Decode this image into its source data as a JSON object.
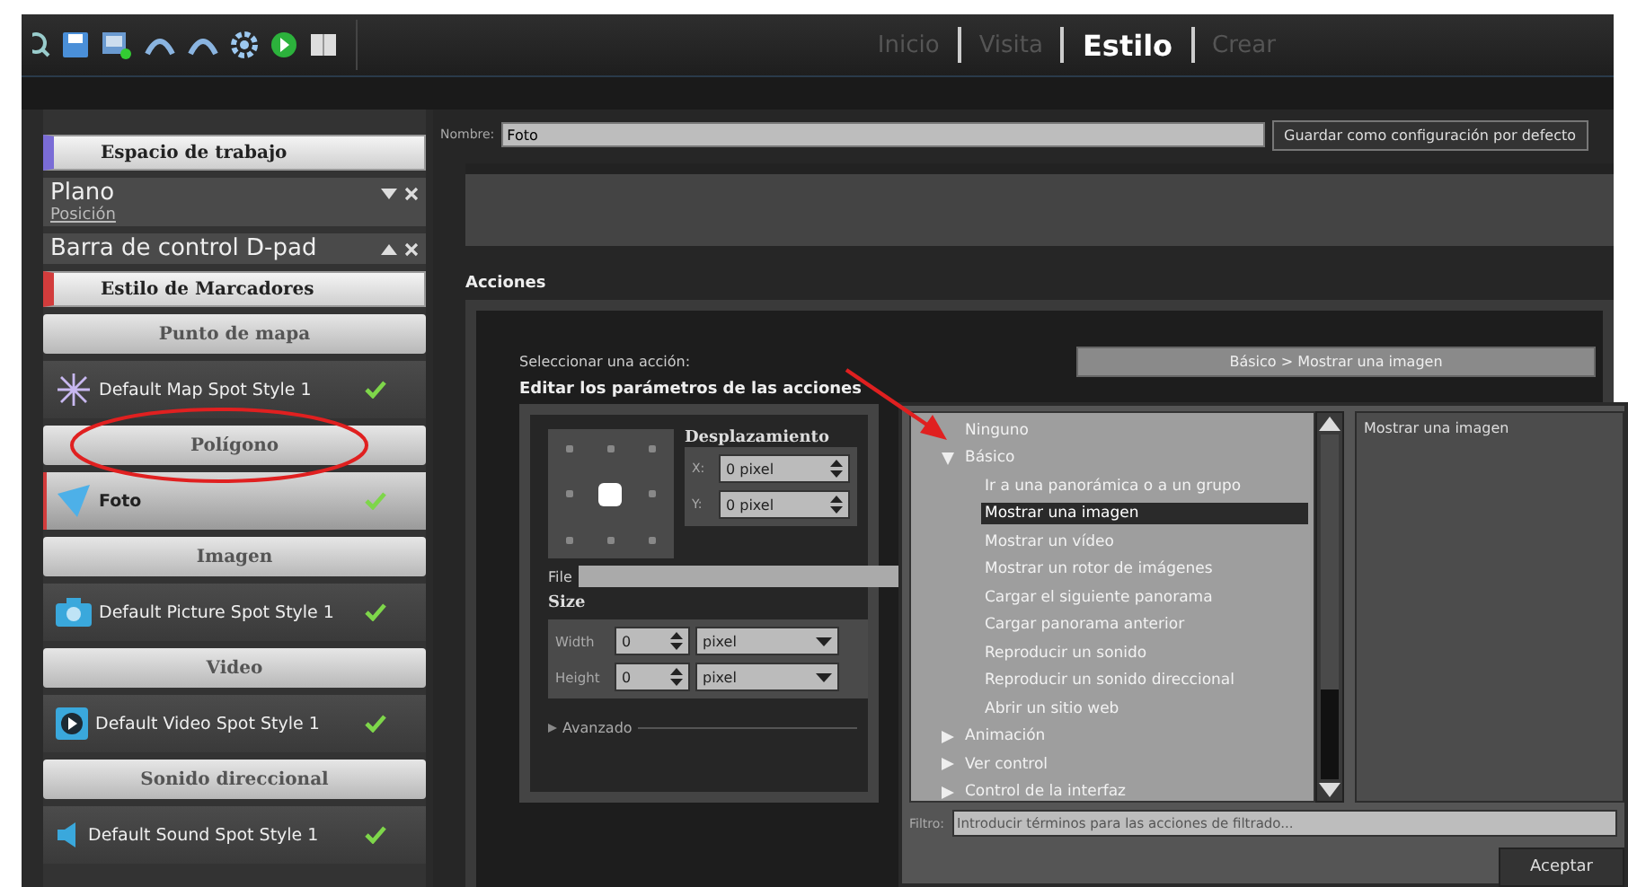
{
  "toolbar": {
    "tabs": [
      {
        "label": "Inicio",
        "selected": false
      },
      {
        "label": "Visita",
        "selected": false
      },
      {
        "label": "Estilo",
        "selected": true
      },
      {
        "label": "Crear",
        "selected": false
      }
    ]
  },
  "sidebar": {
    "items": [
      {
        "kind": "header",
        "label": "Espacio de trabajo",
        "color": "#7a6cd6"
      },
      {
        "kind": "panel",
        "label": "Plano",
        "subtitle": "Posición",
        "expanded": false
      },
      {
        "kind": "panel",
        "label": "Barra de control D-pad",
        "expanded": true
      },
      {
        "kind": "header",
        "label": "Estilo de Marcadores",
        "color": "#d23c3c"
      },
      {
        "kind": "section",
        "label": "Punto de mapa"
      },
      {
        "kind": "map-spot",
        "label": "Default Map Spot Style 1",
        "checked": true,
        "selected": false
      },
      {
        "kind": "section",
        "label": "Polígono"
      },
      {
        "kind": "polygon-spot",
        "label": "Foto",
        "checked": true,
        "selected": true
      },
      {
        "kind": "section",
        "label": "Imagen"
      },
      {
        "kind": "picture-spot",
        "label": "Default Picture Spot Style 1",
        "checked": true,
        "selected": false
      },
      {
        "kind": "section",
        "label": "Video"
      },
      {
        "kind": "video-spot",
        "label": "Default Video Spot Style 1",
        "checked": true,
        "selected": false
      },
      {
        "kind": "section",
        "label": "Sonido direccional"
      },
      {
        "kind": "sound-spot",
        "label": "Default Sound Spot Style 1",
        "checked": true,
        "selected": false
      }
    ]
  },
  "name_field": {
    "label": "Nombre:",
    "value": "Foto"
  },
  "save_default_button": "Guardar como configuración por defecto",
  "actions": {
    "title": "Acciones",
    "select_label": "Seleccionar una acción:",
    "select_value": "Básico > Mostrar una imagen",
    "edit_title": "Editar los parámetros de las acciones",
    "anchor_points": [
      {
        "selected": false
      },
      {
        "selected": false
      },
      {
        "selected": false
      },
      {
        "selected": false
      },
      {
        "selected": true
      },
      {
        "selected": false
      },
      {
        "selected": false
      },
      {
        "selected": false
      },
      {
        "selected": false
      }
    ],
    "offset": {
      "title": "Desplazamiento",
      "rows": [
        {
          "label": "X:",
          "value": "0 pixel"
        },
        {
          "label": "Y:",
          "value": "0 pixel"
        }
      ]
    },
    "file_label": "File",
    "size": {
      "title": "Size",
      "rows": [
        {
          "label": "Width",
          "value": "0",
          "unit": "pixel"
        },
        {
          "label": "Height",
          "value": "0",
          "unit": "pixel"
        }
      ]
    },
    "advanced": {
      "label": "Avanzado",
      "expanded": false
    }
  },
  "action_picker": {
    "tree": [
      {
        "label": "Ninguno",
        "selected": false
      },
      {
        "label": "Básico",
        "selected": false,
        "expanded": true,
        "children": [
          {
            "label": "Ir a una panorámica o a un grupo",
            "selected": false
          },
          {
            "label": "Mostrar una imagen",
            "selected": true
          },
          {
            "label": "Mostrar un vídeo",
            "selected": false
          },
          {
            "label": "Mostrar un rotor de imágenes",
            "selected": false
          },
          {
            "label": "Cargar el siguiente panorama",
            "selected": false
          },
          {
            "label": "Cargar panorama anterior",
            "selected": false
          },
          {
            "label": "Reproducir un sonido",
            "selected": false
          },
          {
            "label": "Reproducir un sonido direccional",
            "selected": false
          },
          {
            "label": "Abrir un sitio web",
            "selected": false
          }
        ]
      },
      {
        "label": "Animación",
        "selected": false,
        "expanded": false
      },
      {
        "label": "Ver control",
        "selected": false,
        "expanded": false
      },
      {
        "label": "Control de la interfaz",
        "selected": false,
        "expanded": false
      }
    ],
    "description": "Mostrar una imagen",
    "filter_label": "Filtro:",
    "filter_placeholder": "Introducir términos para las acciones de filtrado...",
    "accept_button": "Aceptar"
  }
}
